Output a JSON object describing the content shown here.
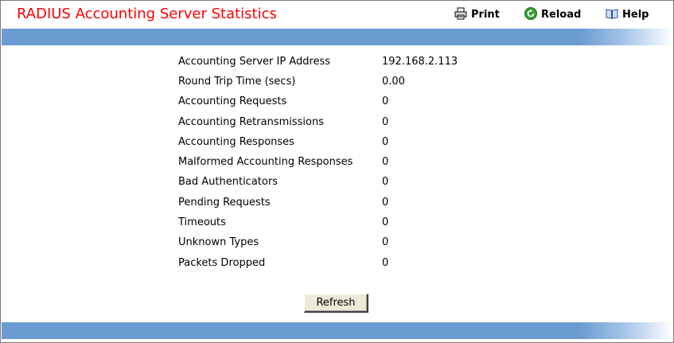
{
  "header": {
    "title": "RADIUS Accounting Server Statistics",
    "title_color": "#ff0000",
    "print_label": "Print",
    "reload_label": "Reload",
    "help_label": "Help",
    "print_icon": "printer-icon",
    "reload_icon": "reload-icon",
    "help_icon": "help-book-icon"
  },
  "bar_color": "#6a9bd1",
  "stats": [
    {
      "label": "Accounting Server IP Address",
      "value": "192.168.2.113"
    },
    {
      "label": "Round Trip Time (secs)",
      "value": "0.00"
    },
    {
      "label": "Accounting Requests",
      "value": "0"
    },
    {
      "label": "Accounting Retransmissions",
      "value": "0"
    },
    {
      "label": "Accounting Responses",
      "value": "0"
    },
    {
      "label": "Malformed Accounting Responses",
      "value": "0"
    },
    {
      "label": "Bad Authenticators",
      "value": "0"
    },
    {
      "label": "Pending Requests",
      "value": "0"
    },
    {
      "label": "Timeouts",
      "value": "0"
    },
    {
      "label": "Unknown Types",
      "value": "0"
    },
    {
      "label": "Packets Dropped",
      "value": "0"
    }
  ],
  "refresh_label": "Refresh"
}
